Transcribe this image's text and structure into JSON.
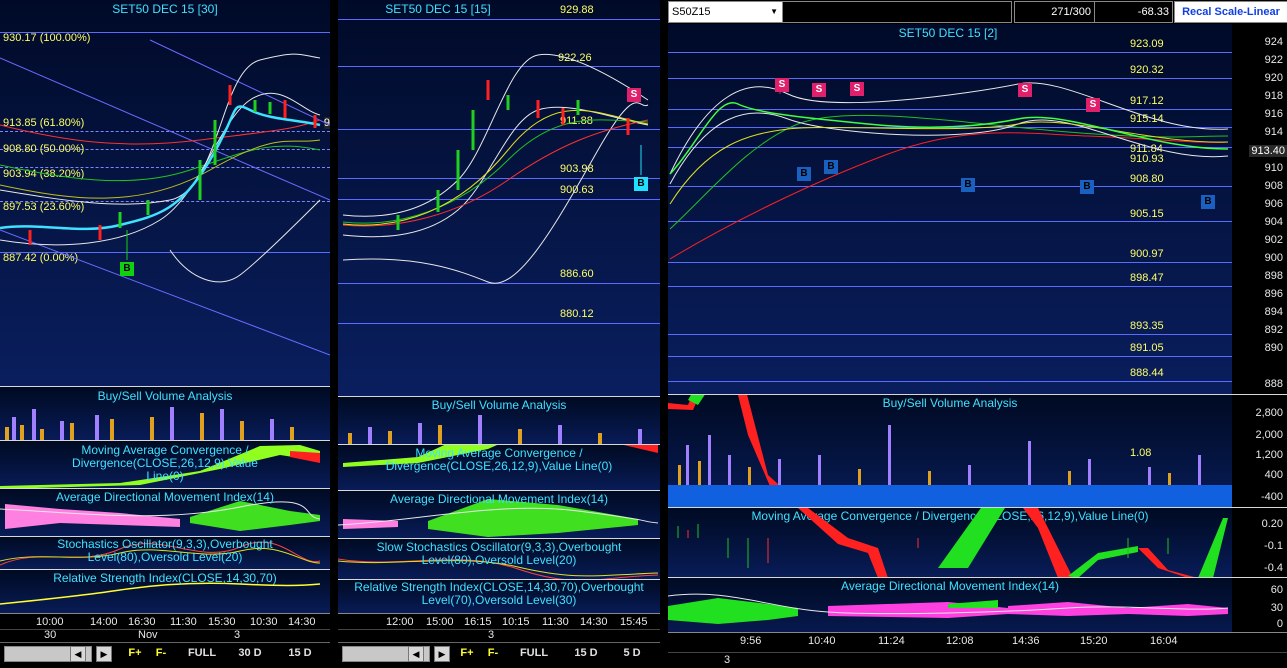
{
  "panel1": {
    "title": "SET50 DEC 15  [30]",
    "fib": [
      "930.17 (100.00%)",
      "913.85 (61.80%)",
      "908.80 (50.00%)",
      "903.94 (38.20%)",
      "897.53 (23.60%)",
      "887.42 (0.00%)"
    ],
    "price_tag": "9",
    "signals": [
      "B"
    ],
    "sub_titles": [
      "Buy/Sell Volume Analysis",
      "Moving Average Convergence / Divergence(CLOSE,26,12,9),Value Line(0)",
      "Average Directional Movement Index(14)",
      "Stochastics Oscillator(9,3,3),Overbought Level(80),Oversold Level(20)",
      "Relative Strength Index(CLOSE,14,30,70)"
    ],
    "times": [
      "10:00",
      "14:00",
      "16:30",
      "11:30",
      "15:30",
      "10:30",
      "14:30"
    ],
    "dates": [
      "30",
      "Nov",
      "3"
    ],
    "toolbar": [
      "F+",
      "F-",
      "FULL",
      "30 D",
      "15 D"
    ]
  },
  "panel2": {
    "title": "SET50 DEC 15  [15]",
    "levels": [
      "929.88",
      "922.26",
      "911.88",
      "903.98",
      "900.63",
      "886.60",
      "880.12"
    ],
    "signals": [
      "S",
      "B"
    ],
    "sub_titles": [
      "Buy/Sell Volume Analysis",
      "Moving Average Convergence / Divergence(CLOSE,26,12,9),Value Line(0)",
      "Average Directional Movement Index(14)",
      "Slow Stochastics Oscillator(9,3,3),Overbought Level(80),Oversold Level(20)",
      "Relative Strength Index(CLOSE,14,30,70),Overbought Level(70),Oversold Level(30)"
    ],
    "times": [
      "12:00",
      "15:00",
      "16:15",
      "10:15",
      "11:30",
      "14:30",
      "15:45"
    ],
    "dates": [
      "3"
    ],
    "toolbar": [
      "F+",
      "F-",
      "FULL",
      "15 D",
      "5 D"
    ]
  },
  "panel3": {
    "symbol": "S50Z15",
    "counter": "271/300",
    "change": "-68.33",
    "recal": "Recal Scale-Linear",
    "title": "SET50 DEC 15  [2]",
    "levels": [
      "923.09",
      "920.32",
      "917.12",
      "915.14",
      "911.84",
      "910.93",
      "908.80",
      "905.15",
      "900.97",
      "898.47",
      "893.35",
      "891.05",
      "888.44"
    ],
    "price": "913.40",
    "yticks": [
      "924",
      "922",
      "920",
      "918",
      "916",
      "914",
      "912",
      "910",
      "908",
      "906",
      "904",
      "902",
      "900",
      "898",
      "896",
      "894",
      "892",
      "890",
      "888"
    ],
    "signals": [
      "S",
      "S",
      "S",
      "S",
      "S",
      "B",
      "B",
      "B",
      "B",
      "B"
    ],
    "vol_title": "Buy/Sell Volume Analysis",
    "vol_value": "1.08",
    "vol_ticks": [
      "2,800",
      "2,000",
      "1,200",
      "400",
      "-400"
    ],
    "macd_title": "Moving Average Convergence / Divergence(CLOSE,26,12,9),Value Line(0)",
    "macd_ticks": [
      "0.20",
      "-0.1",
      "-0.4"
    ],
    "adx_title": "Average Directional Movement Index(14)",
    "adx_ticks": [
      "60",
      "30",
      "0"
    ],
    "times": [
      "9:56",
      "10:40",
      "11:24",
      "12:08",
      "14:36",
      "15:20",
      "16:04"
    ],
    "dates": [
      "3"
    ]
  },
  "colors": {
    "accent": "#40e0ff",
    "label": "#ffff66",
    "sell": "#e0206a",
    "buy": "#1a60c0"
  }
}
